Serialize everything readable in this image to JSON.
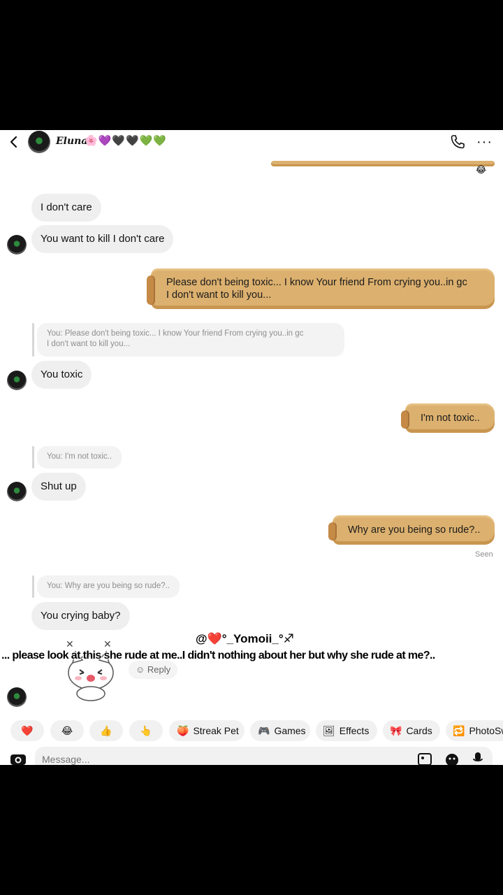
{
  "header": {
    "contact_name": "Eluna",
    "name_emojis": "🌸💜🖤🖤💚💚"
  },
  "messages": {
    "m1": "I don't care",
    "m2": "You want to kill I don't care",
    "m3_line1": "Please don't being toxic... I know Your friend From crying you..in gc",
    "m3_line2": "I don't want to kill you...",
    "q1_line1": "You: Please don't being toxic... I know Your friend From crying you..in gc",
    "q1_line2": "I don't want to kill you...",
    "m4": "You toxic",
    "m5": "I'm not toxic..",
    "q2": "You: I'm not toxic..",
    "m6": "Shut up",
    "m7": "Why are you being so rude?..",
    "seen": "Seen",
    "q3": "You: Why are you being so rude?..",
    "m8": "You crying baby?",
    "reaction": "😂"
  },
  "overlay": {
    "username": "@❤️°_Yomoii_°♐",
    "caption": "... please look at this she rude at me..I didn't nothing about her but why she rude at me?.."
  },
  "reply_label": "Reply",
  "chips": [
    {
      "icon": "❤️",
      "label": ""
    },
    {
      "icon": "😂",
      "label": ""
    },
    {
      "icon": "👍",
      "label": ""
    },
    {
      "icon": "👆",
      "label": ""
    },
    {
      "icon": "🍑",
      "label": "Streak Pet"
    },
    {
      "icon": "🎮",
      "label": "Games"
    },
    {
      "icon": "🖼",
      "label": "Effects"
    },
    {
      "icon": "🎀",
      "label": "Cards"
    },
    {
      "icon": "🔁",
      "label": "PhotoSw"
    }
  ],
  "composer": {
    "placeholder": "Message..."
  }
}
